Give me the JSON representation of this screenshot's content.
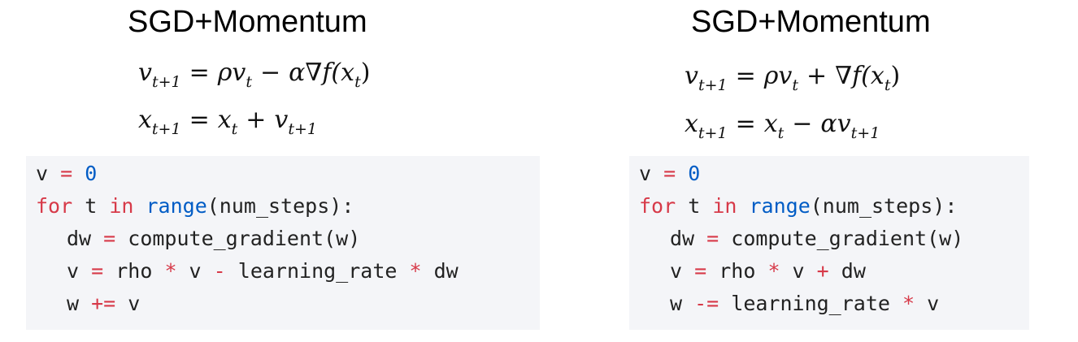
{
  "left": {
    "title": "SGD+Momentum",
    "eq1": {
      "lhs": "v",
      "lhs_sub": "t+1",
      "eq": "=",
      "t1": "ρv",
      "t1_sub": "t",
      "op": "−",
      "t2": "α∇f(x",
      "t2_sub": "t",
      "t2_end": ")"
    },
    "eq2": {
      "lhs": "x",
      "lhs_sub": "t+1",
      "eq": "=",
      "t1": "x",
      "t1_sub": "t",
      "op": "+",
      "t2": "v",
      "t2_sub": "t+1"
    },
    "code": {
      "l1": {
        "a": "v ",
        "op": "=",
        "b": " ",
        "num": "0"
      },
      "l2": {
        "kw1": "for",
        "a": " t ",
        "kw2": "in",
        "b": " ",
        "fn": "range",
        "c": "(num_steps):"
      },
      "l3": {
        "a": "dw ",
        "op": "=",
        "b": " compute_gradient(w)"
      },
      "l4": {
        "a": "v ",
        "op1": "=",
        "b": " rho ",
        "op2": "*",
        "c": " v ",
        "op3": "-",
        "d": " learning_rate ",
        "op4": "*",
        "e": " dw"
      },
      "l5": {
        "a": "w ",
        "op": "+=",
        "b": " v"
      }
    }
  },
  "right": {
    "title": "SGD+Momentum",
    "eq1": {
      "lhs": "v",
      "lhs_sub": "t+1",
      "eq": "=",
      "t1": "ρv",
      "t1_sub": "t",
      "op": "+",
      "t2": "∇f(x",
      "t2_sub": "t",
      "t2_end": ")"
    },
    "eq2": {
      "lhs": "x",
      "lhs_sub": "t+1",
      "eq": "=",
      "t1": "x",
      "t1_sub": "t",
      "op": "−",
      "t2": "αv",
      "t2_sub": "t+1"
    },
    "code": {
      "l1": {
        "a": "v ",
        "op": "=",
        "b": " ",
        "num": "0"
      },
      "l2": {
        "kw1": "for",
        "a": " t ",
        "kw2": "in",
        "b": " ",
        "fn": "range",
        "c": "(num_steps):"
      },
      "l3": {
        "a": "dw ",
        "op": "=",
        "b": " compute_gradient(w)"
      },
      "l4": {
        "a": "v ",
        "op1": "=",
        "b": " rho ",
        "op2": "*",
        "c": " v ",
        "op3": "+",
        "d": " dw"
      },
      "l5": {
        "a": "w ",
        "op": "-=",
        "b": " learning_rate ",
        "op2": "*",
        "c": " v"
      }
    }
  }
}
